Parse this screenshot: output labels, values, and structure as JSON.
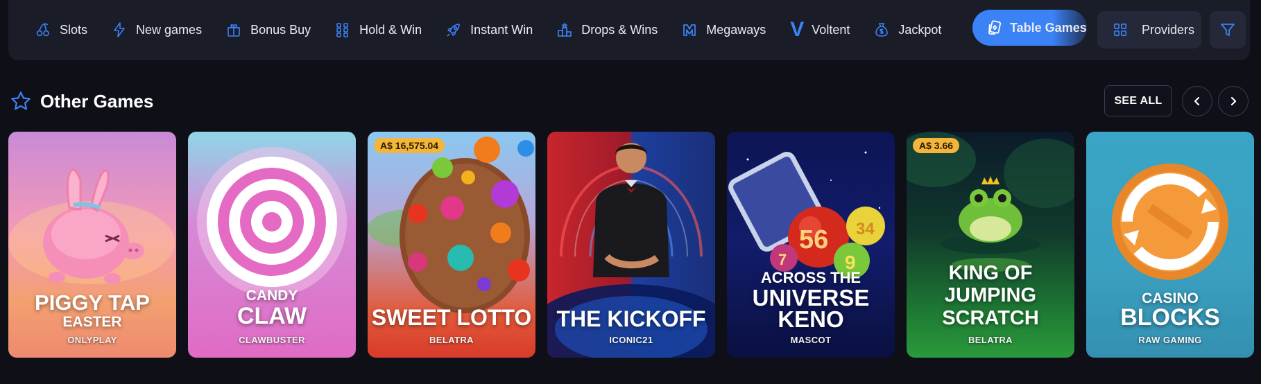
{
  "nav": {
    "items": [
      {
        "label": "Slots",
        "icon": "cherries-icon"
      },
      {
        "label": "New games",
        "icon": "lightning-icon"
      },
      {
        "label": "Bonus Buy",
        "icon": "gift-icon"
      },
      {
        "label": "Hold & Win",
        "icon": "grid-dots-icon"
      },
      {
        "label": "Instant Win",
        "icon": "rocket-icon"
      },
      {
        "label": "Drops & Wins",
        "icon": "podium-icon"
      },
      {
        "label": "Megaways",
        "icon": "megaways-m-icon"
      },
      {
        "label": "Voltent",
        "icon": "voltent-v-icon"
      },
      {
        "label": "Jackpot",
        "icon": "money-bag-icon"
      }
    ],
    "active": {
      "label": "Table Games",
      "icon": "cards-icon"
    },
    "providers_label": "Providers",
    "accent_color": "#3b82f6"
  },
  "section": {
    "title": "Other Games",
    "see_all_label": "SEE ALL"
  },
  "games": [
    {
      "title_lines": [
        "PIGGY TAP",
        "EASTER"
      ],
      "provider": "ONLYPLAY",
      "badge": ""
    },
    {
      "title_lines": [
        "CANDY",
        "CLAW"
      ],
      "provider": "CLAWBUSTER",
      "badge": ""
    },
    {
      "title_lines": [
        "SWEET LOTTO"
      ],
      "provider": "BELATRA",
      "badge": "A$ 16,575.04"
    },
    {
      "title_lines": [
        "THE KICKOFF"
      ],
      "provider": "ICONIC21",
      "badge": ""
    },
    {
      "title_lines": [
        "ACROSS THE",
        "UNIVERSE",
        "KENO"
      ],
      "provider": "MASCOT",
      "badge": ""
    },
    {
      "title_lines": [
        "KING OF",
        "JUMPING",
        "SCRATCH"
      ],
      "provider": "BELATRA",
      "badge": "A$ 3.66"
    },
    {
      "title_lines": [
        "CASINO",
        "BLOCKS"
      ],
      "provider": "RAW GAMING",
      "badge": ""
    }
  ]
}
